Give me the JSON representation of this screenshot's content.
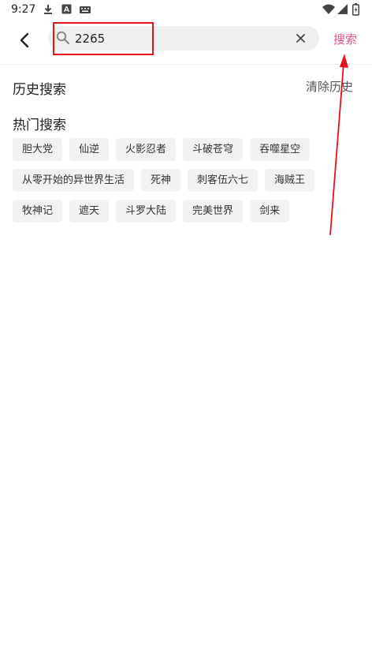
{
  "status_bar": {
    "time": "9:27",
    "left_icons": [
      "download-icon",
      "store-icon",
      "keyboard-icon"
    ],
    "right_icons": [
      "wifi-icon",
      "signal-icon",
      "battery-icon"
    ]
  },
  "header": {
    "search": {
      "value": "2265",
      "placeholder": ""
    },
    "search_button": "搜索"
  },
  "history": {
    "title": "历史搜索",
    "clear_label": "清除历史"
  },
  "hot": {
    "title": "热门搜索",
    "rows": [
      [
        "胆大党",
        "仙逆",
        "火影忍者",
        "斗破苍穹",
        "吞噬星空"
      ],
      [
        "从零开始的异世界生活",
        "死神",
        "刺客伍六七",
        "海贼王"
      ],
      [
        "牧神记",
        "遮天",
        "斗罗大陆",
        "完美世界",
        "剑来"
      ]
    ]
  },
  "colors": {
    "accent": "#e8517f",
    "annotation": "#e8101a",
    "tag_bg": "#f2f2f2",
    "search_bg": "#efefef"
  }
}
